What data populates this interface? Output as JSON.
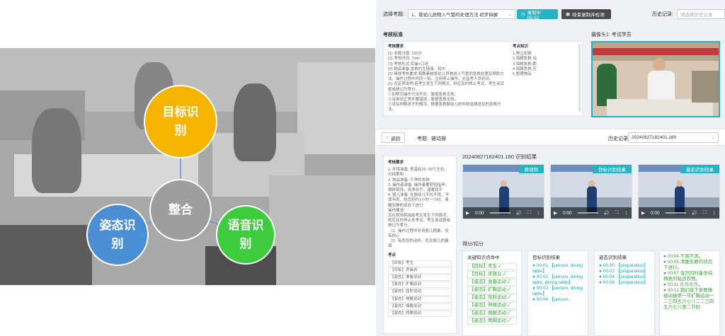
{
  "hub": {
    "merge": "整合",
    "target": "目标识别",
    "pose": "姿态识别",
    "voice": "语音识别",
    "colors": {
      "target": "#f4b400",
      "merge": "#9e9e9e",
      "pose": "#4a8fd4",
      "voice": "#3dcc3d"
    }
  },
  "top": {
    "exam_label": "选择考题:",
    "exam_value": "1、婴幼儿异物入气管的处理方法 初步拆解",
    "recording": "录制中 05:02",
    "end_button": "结束录制并检测",
    "history_label": "历史记录:",
    "history_placeholder": "请选择历史记录"
  },
  "criteria": {
    "section_title": "考核标准",
    "col_req": "考核要求",
    "col_points": "考点知识",
    "requirements": [
      "(1) 本题分值: 100分",
      "(2) 考核时间: 7min",
      "(3) 考核形式:实操+口述",
      "(4) 物品准备:急救约生链接、短巾",
      "(5) 具体考核要求:我教素被婴幼儿异物进入气管的急救处理及预防方法。操作过程中时同一刻。立刻停止操作。交监考人员初评。",
      "(6) 否定项说明:若考生发生下列情况，则应及时终止考试，考生该试题成绩记为零分。",
      "①如帮活操作方法不对、致使急救无效。",
      "②没用到正常步骤错误，致使急救无效。",
      "③没有判断孩子的情况、根据急救婴幼儿的年龄选择送往的急救方法。"
    ],
    "points": [
      "1.物立初掉",
      "2.海姆急救-站",
      "3.海姆急救-跪",
      "4.海姆急救-压",
      "5.整理物品"
    ]
  },
  "camera": {
    "title": "摄像头1:  考试学员"
  },
  "result_bar": {
    "back": "返回",
    "exam_label": "考题:",
    "exam_value": "被动操",
    "history_label": "历史记录",
    "history_value": "20240827182401.180"
  },
  "side": {
    "title": "考核要求",
    "lines": [
      "1. 环境准备: 室温在25~28℃左右，光线柔和",
      "2. 物品准备: 干净的衣物",
      "3. 操作者准备: 操作者要剪短指甲，摘掉首饰，洗净双手，温暖双手",
      "4. 婴儿准备: 在婴幼儿不饥不饱、不哭不闹、吃完奶约1小时一小时，清醒安静的状态下进行",
      "操作要求:",
      "否在现场将指给考生发生下列情况，则应及时停止本考试，考生该试题成绩记为零分。",
      "（1）操作过程中对待婴儿粗暴、没有耐心",
      "（2）有危险的动作，危及婴儿的健康"
    ],
    "points_title": "考点",
    "points": [
      "【目标】考生",
      "【目标】卖操台",
      "【姿态】准备运动",
      "【姿态】扩胸运动",
      "【姿态】屈肘运动",
      "【姿态】伸展运动",
      "【姿态】曲腿运动",
      "【姿态】两脚运动"
    ]
  },
  "results": {
    "title": "20240827182401.180 识别结果",
    "videos": [
      {
        "tag": "原视频",
        "time": "0:00"
      },
      {
        "tag": "目标识别结果",
        "time": "0:00"
      },
      {
        "tag": "姿态识别结果",
        "time": "0:00"
      }
    ]
  },
  "scores": {
    "title": "得分/扣分",
    "keypoints_title": "关键知识点命中",
    "keypoints": [
      "【目标】考生 ✓",
      "【目标】卖操台 ✓",
      "【姿态】准备运动 ✓",
      "【姿态】扩胸运动 ✓",
      "【姿态】屈肘运动 ✓",
      "【姿态】伸展运动 ✓",
      "【姿态】曲腿运动 ✓",
      "【姿态】两脚运动 ✓"
    ],
    "target_title": "目标识别结果",
    "target": [
      "● 00:01 【person, dining table】",
      "● 00:02 【person, dining table, dining table】",
      "● 00:03 【person, dining table】",
      "● 00:04 【person,"
    ],
    "pose_title": "姿态识别结果",
    "pose": [
      "● 00:00 【preparation】",
      "● 00:02 【preparation】",
      "● 00:04 【preparation】",
      "● 00:06 【preparation】"
    ],
    "voice": [
      "● 00:04 不哭不闹。",
      "● 00:05 清醒安静的状态下进行。",
      "● 00:07 宝贝同时备孕纯棉质的贴适衣物。",
      "● 00:11 乐乐乐乐。",
      "● 00:12 我们接下来要做被动操第一节扩胸运动一二三四五六七八二二三四五六七八第二节肘"
    ]
  }
}
